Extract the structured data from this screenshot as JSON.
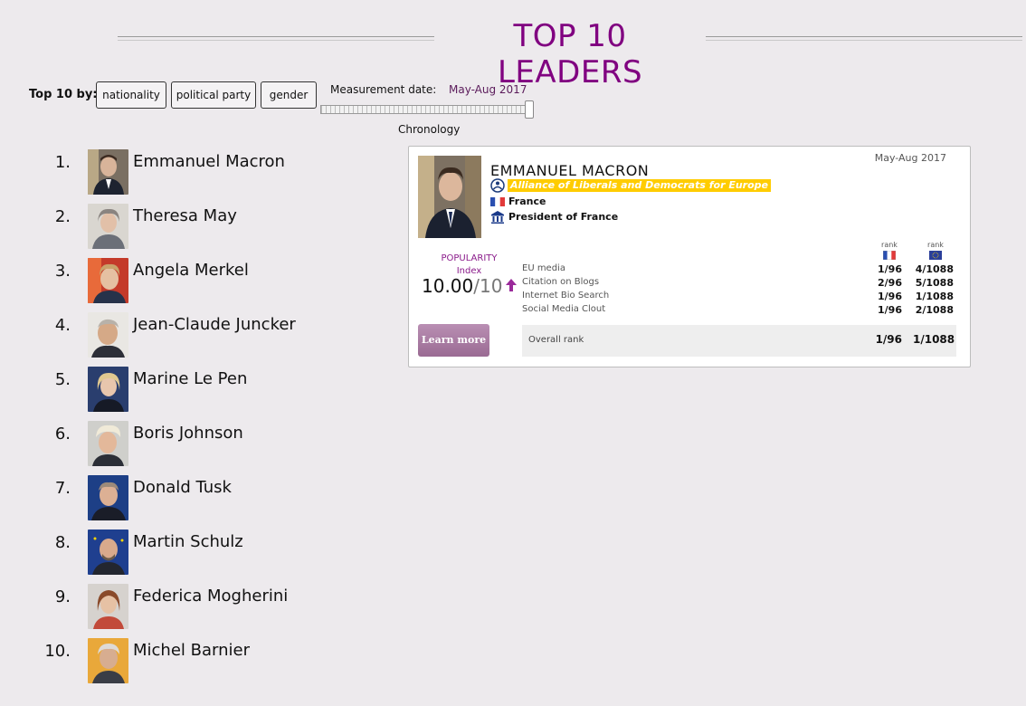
{
  "page_title": "TOP 10 LEADERS",
  "filters": {
    "label": "Top 10 by:",
    "buttons": [
      "nationality",
      "political party",
      "gender"
    ]
  },
  "measurement": {
    "label": "Measurement date:",
    "value": "May-Aug 2017",
    "slider_label": "Chronology"
  },
  "leaders": [
    {
      "rank": "1.",
      "name": "Emmanuel Macron"
    },
    {
      "rank": "2.",
      "name": "Theresa May"
    },
    {
      "rank": "3.",
      "name": "Angela Merkel"
    },
    {
      "rank": "4.",
      "name": "Jean-Claude Juncker"
    },
    {
      "rank": "5.",
      "name": "Marine Le Pen"
    },
    {
      "rank": "6.",
      "name": "Boris Johnson"
    },
    {
      "rank": "7.",
      "name": "Donald Tusk"
    },
    {
      "rank": "8.",
      "name": "Martin Schulz"
    },
    {
      "rank": "9.",
      "name": "Federica Mogherini"
    },
    {
      "rank": "10.",
      "name": "Michel Barnier"
    }
  ],
  "profile": {
    "date": "May-Aug 2017",
    "name": "EMMANUEL MACRON",
    "party": "Alliance of Liberals and Democrats for Europe",
    "country": "France",
    "position": "President of France",
    "popularity_label_1": "POPULARITY",
    "popularity_label_2": "Index",
    "popularity_value": "10.00",
    "popularity_max": "/10",
    "rank_header_1": "rank",
    "rank_header_2": "rank",
    "metrics": [
      {
        "label": "EU media",
        "rank_country": "1/96",
        "rank_eu": "4/1088"
      },
      {
        "label": "Citation on Blogs",
        "rank_country": "2/96",
        "rank_eu": "5/1088"
      },
      {
        "label": "Internet Bio Search",
        "rank_country": "1/96",
        "rank_eu": "1/1088"
      },
      {
        "label": "Social Media Clout",
        "rank_country": "1/96",
        "rank_eu": "2/1088"
      }
    ],
    "overall": {
      "label": "Overall rank",
      "rank_country": "1/96",
      "rank_eu": "1/1088"
    },
    "learn_more": "Learn more"
  }
}
